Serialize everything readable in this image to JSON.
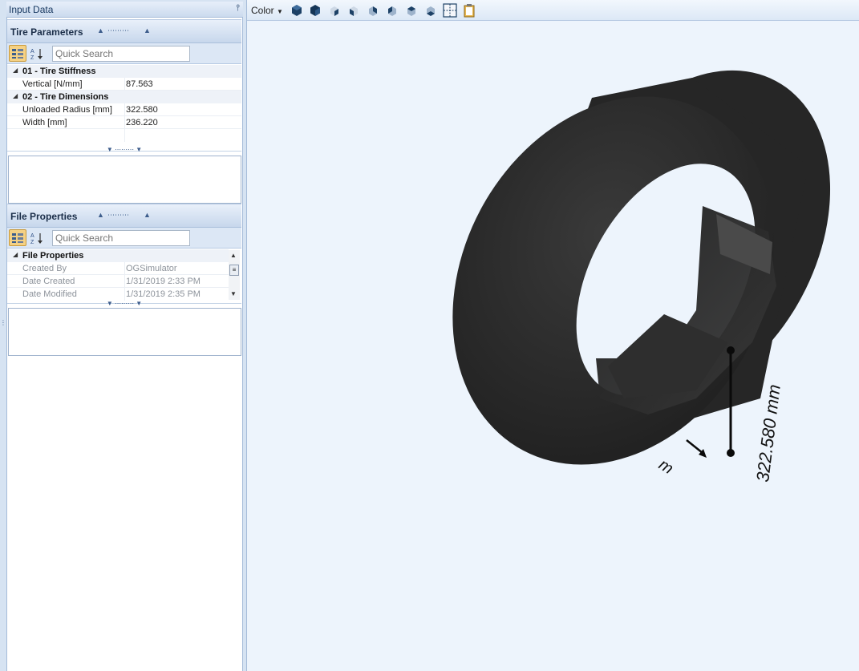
{
  "pane": {
    "title": "Input Data",
    "pin_icon": "pin-icon"
  },
  "tire_parameters": {
    "title": "Tire Parameters",
    "search_placeholder": "Quick Search",
    "categories": [
      {
        "label": "01 - Tire Stiffness",
        "rows": [
          {
            "name": "Vertical [N/mm]",
            "value": "87.563"
          }
        ]
      },
      {
        "label": "02 - Tire Dimensions",
        "rows": [
          {
            "name": "Unloaded Radius [mm]",
            "value": "322.580"
          },
          {
            "name": "Width [mm]",
            "value": "236.220"
          }
        ]
      }
    ]
  },
  "file_properties": {
    "title": "File Properties",
    "search_placeholder": "Quick Search",
    "categories": [
      {
        "label": "File Properties",
        "rows": [
          {
            "name": "Created By",
            "value": "OGSimulator"
          },
          {
            "name": "Date Created",
            "value": "1/31/2019 2:33 PM"
          },
          {
            "name": "Date Modified",
            "value": "1/31/2019 2:35 PM"
          }
        ]
      }
    ]
  },
  "viewer": {
    "color_menu": "Color",
    "toolbar_icons": [
      "solid-iso-icon",
      "solid-iso-alt-icon",
      "front-view-icon",
      "left-view-icon",
      "right-view-icon",
      "back-view-icon",
      "top-view-icon",
      "bottom-view-icon",
      "grid-toggle-icon",
      "clipboard-icon"
    ],
    "radius_annotation": "322.580 mm",
    "width_annotation_fragment": "m"
  },
  "colors": {
    "accent": "#f5d184",
    "header_text": "#15365e",
    "tire": "#2c2c2c",
    "viewport_bg": "#edf4fc"
  }
}
